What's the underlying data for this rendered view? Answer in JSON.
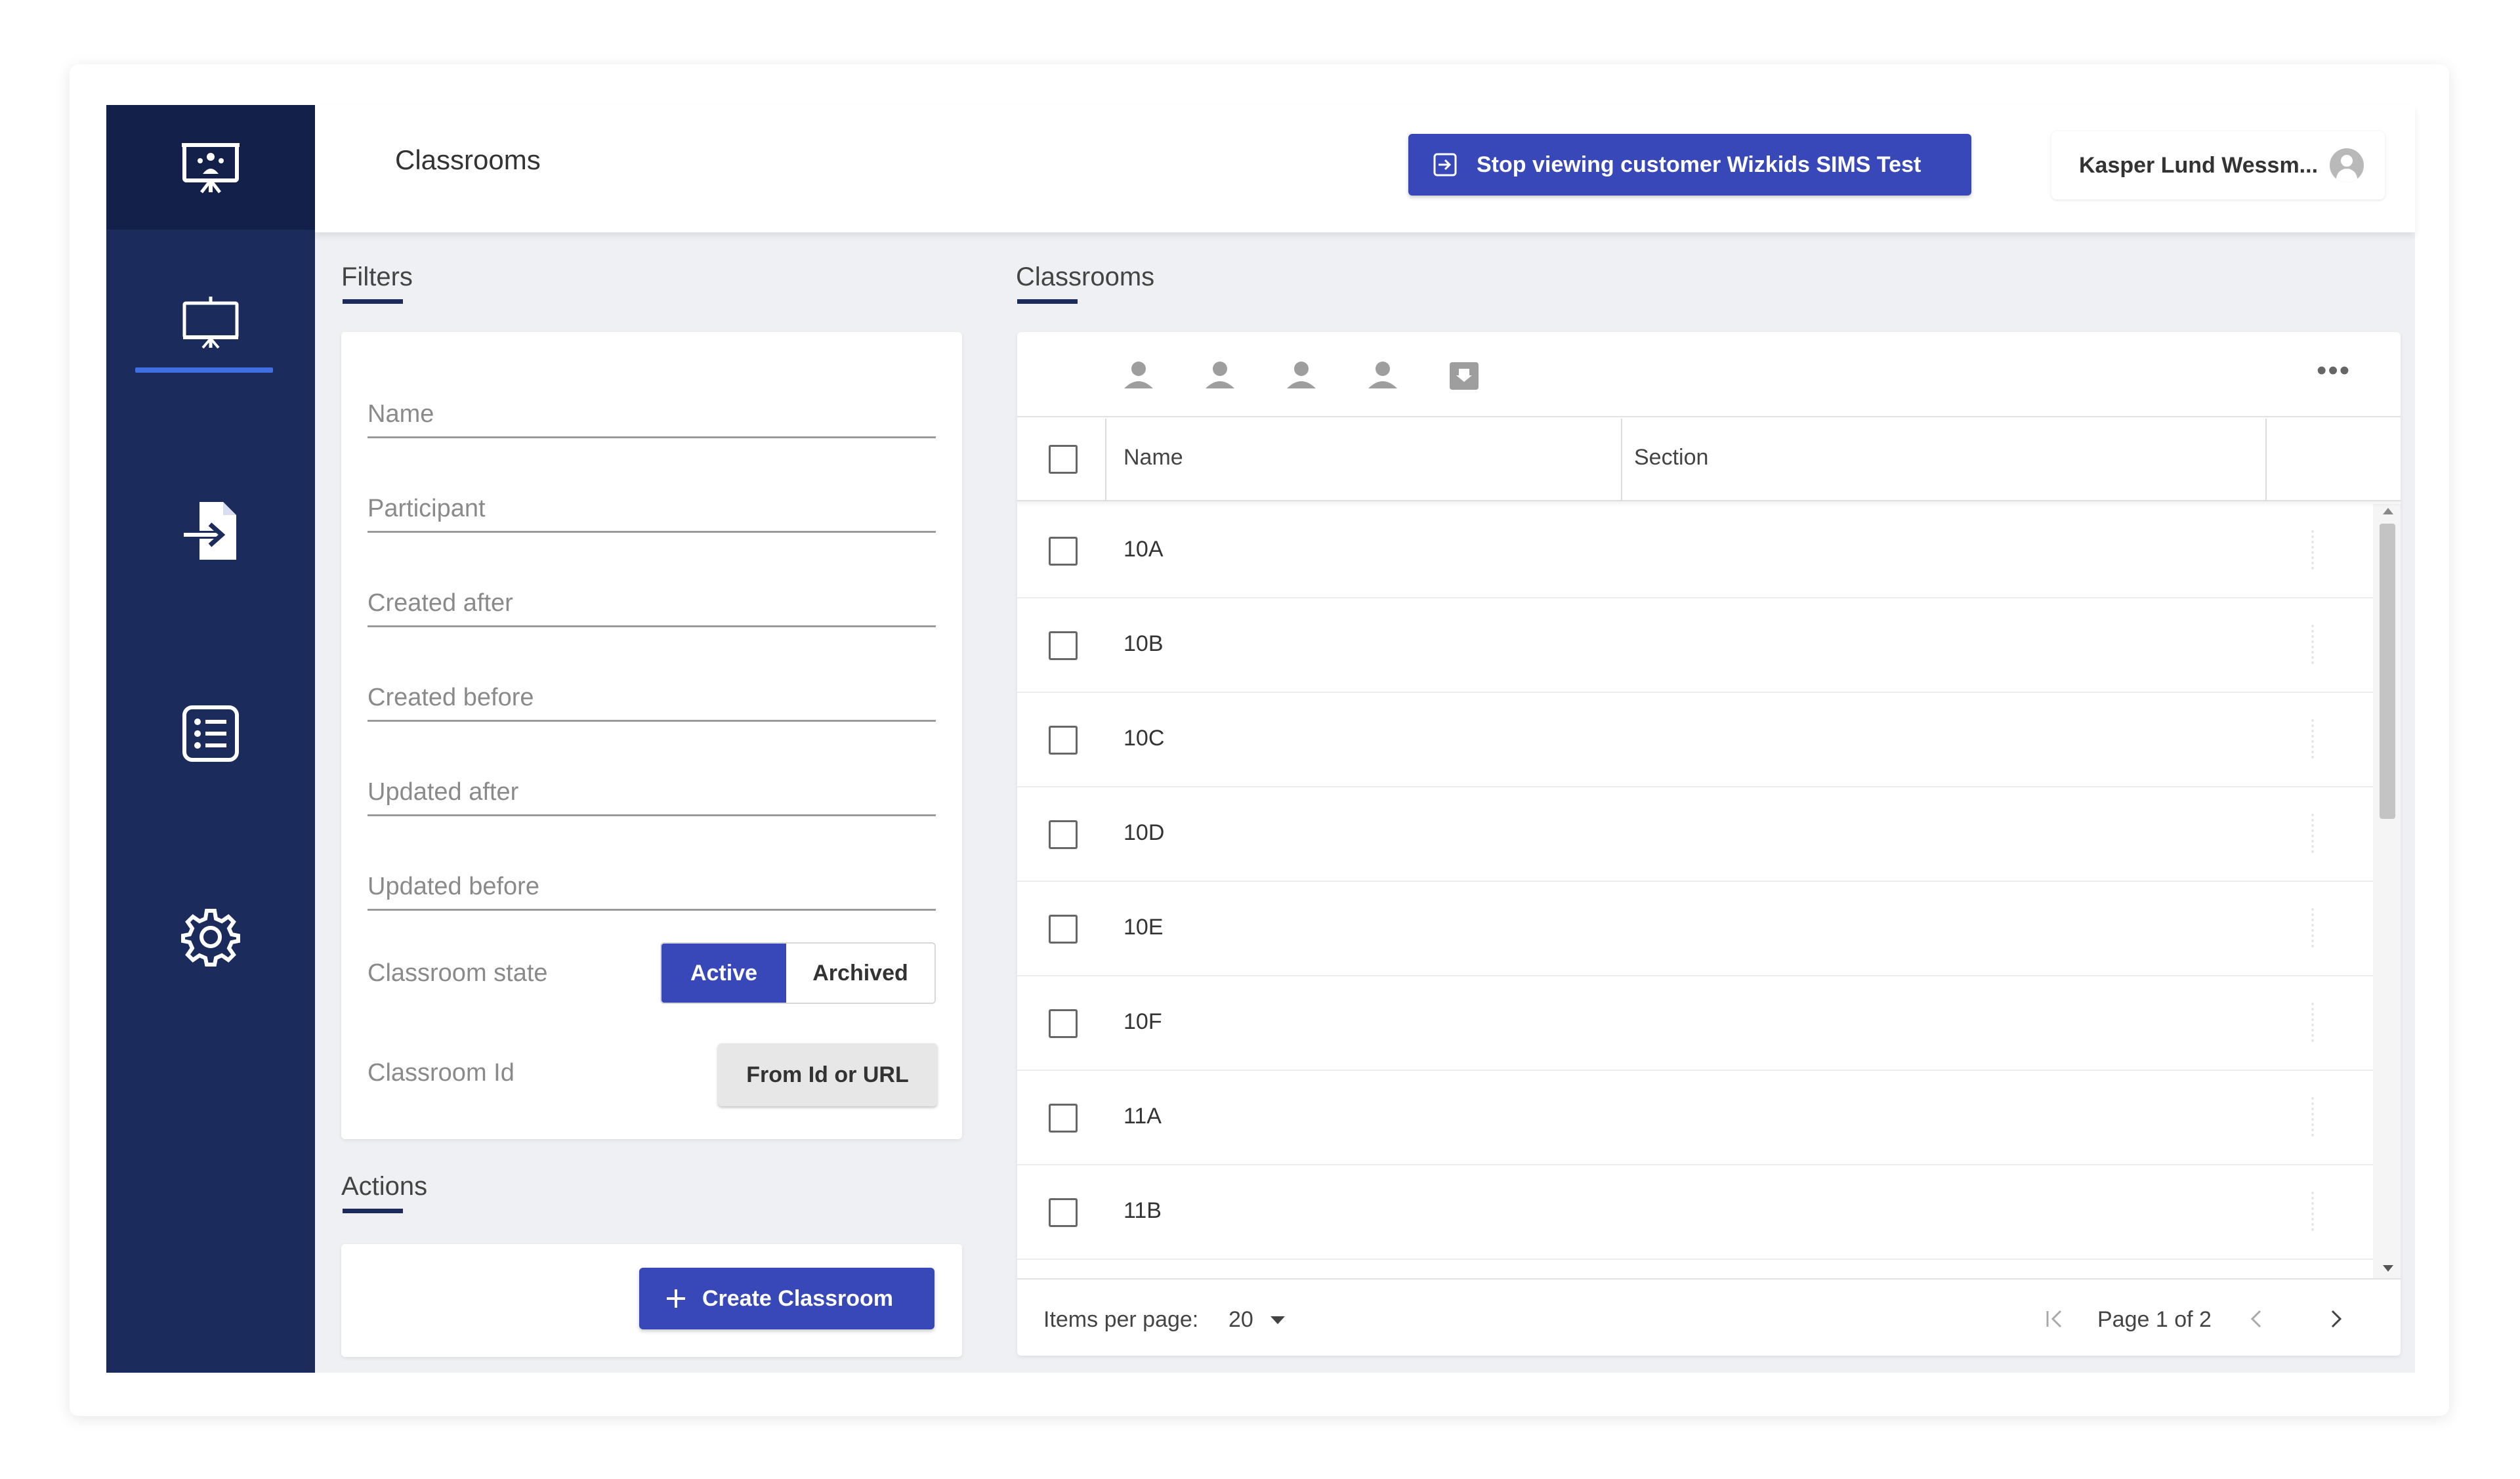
{
  "header": {
    "title": "Classrooms",
    "stop_viewing_label": "Stop viewing customer Wizkids SIMS Test",
    "user_name": "Kasper Lund Wessm..."
  },
  "sidebar": {
    "items": [
      {
        "icon": "presentation-logo-icon"
      },
      {
        "icon": "classroom-board-icon",
        "active": true
      },
      {
        "icon": "import-file-icon"
      },
      {
        "icon": "list-icon"
      },
      {
        "icon": "gear-icon"
      }
    ]
  },
  "filters": {
    "section_label": "Filters",
    "fields": [
      {
        "placeholder": "Name",
        "value": ""
      },
      {
        "placeholder": "Participant",
        "value": ""
      },
      {
        "placeholder": "Created after",
        "value": ""
      },
      {
        "placeholder": "Created before",
        "value": ""
      },
      {
        "placeholder": "Updated after",
        "value": ""
      },
      {
        "placeholder": "Updated before",
        "value": ""
      }
    ],
    "state_label": "Classroom state",
    "state_options": [
      "Active",
      "Archived"
    ],
    "state_selected": "Active",
    "id_label": "Classroom Id",
    "from_id_button": "From Id or URL"
  },
  "actions": {
    "section_label": "Actions",
    "create_button": "Create Classroom"
  },
  "classrooms": {
    "section_label": "Classrooms",
    "toolbar_icons": [
      "person-icon",
      "person-icon",
      "person-icon",
      "person-icon",
      "archive-icon"
    ],
    "columns": [
      "Name",
      "Section"
    ],
    "rows": [
      {
        "name": "10A",
        "section": ""
      },
      {
        "name": "10B",
        "section": ""
      },
      {
        "name": "10C",
        "section": ""
      },
      {
        "name": "10D",
        "section": ""
      },
      {
        "name": "10E",
        "section": ""
      },
      {
        "name": "10F",
        "section": ""
      },
      {
        "name": "11A",
        "section": ""
      },
      {
        "name": "11B",
        "section": ""
      }
    ],
    "paginator": {
      "items_per_page_label": "Items per page:",
      "items_per_page": "20",
      "page_label": "Page 1 of 2"
    }
  },
  "colors": {
    "sidebar": "#1a2b5c",
    "primary_button": "#3848b8",
    "accent": "#3f6fe0"
  }
}
